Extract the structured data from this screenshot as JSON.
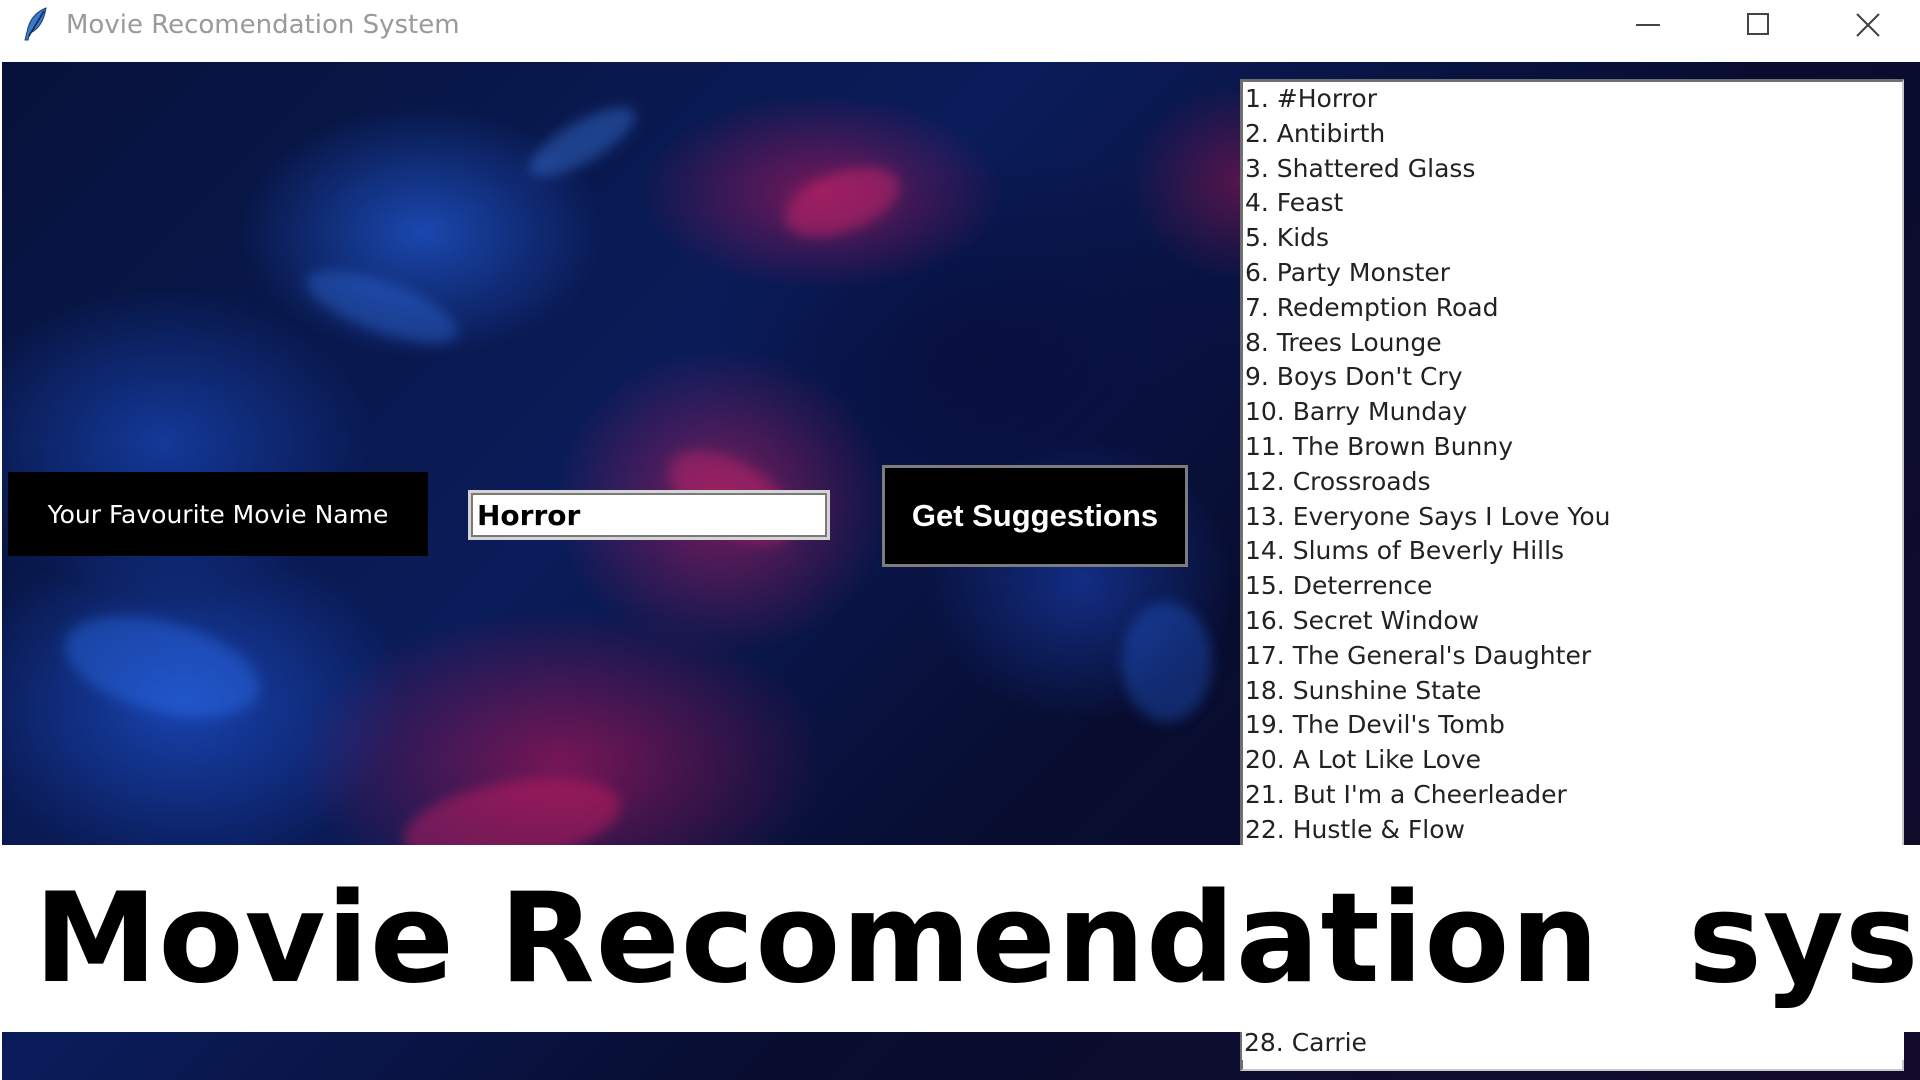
{
  "window": {
    "title": "Movie Recomendation System",
    "icon": "feather-icon",
    "controls": [
      "minimize-icon",
      "maximize-icon",
      "close-icon"
    ]
  },
  "form": {
    "label": "Your Favourite Movie Name",
    "input_value": "Horror",
    "button_label": "Get Suggestions"
  },
  "results": [
    "1. #Horror",
    "2. Antibirth",
    "3. Shattered Glass",
    "4. Feast",
    "5. Kids",
    "6. Party Monster",
    "7. Redemption Road",
    "8. Trees Lounge",
    "9. Boys Don't Cry",
    "10. Barry Munday",
    "11. The Brown Bunny",
    "12. Crossroads",
    "13. Everyone Says I Love You",
    "14. Slums of Beverly Hills",
    "15. Deterrence",
    "16. Secret Window",
    "17. The General's Daughter",
    "18. Sunshine State",
    "19. The Devil's Tomb",
    "20. A Lot Like Love",
    "21. But I'm a Cheerleader",
    "22. Hustle & Flow"
  ],
  "results_partial_last": "28. Carrie",
  "banner": {
    "text": "Movie Recomendation  system"
  },
  "colors": {
    "background_blue": "#0a1c5a",
    "background_pink": "#c8145a",
    "button_bg": "#000000",
    "label_bg": "#000000"
  }
}
